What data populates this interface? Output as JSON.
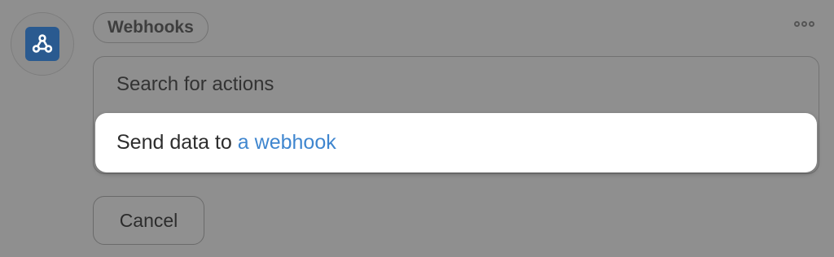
{
  "app": {
    "icon": "webhook-icon",
    "name": "Webhooks",
    "brand_color": "#2a5a90"
  },
  "menu": {
    "icon": "more-options-icon"
  },
  "search": {
    "placeholder": "Search for actions",
    "value": ""
  },
  "actions": [
    {
      "prefix": "Send data to",
      "link_text": "a webhook",
      "link_color": "#3f86cf"
    }
  ],
  "footer": {
    "cancel_label": "Cancel"
  }
}
